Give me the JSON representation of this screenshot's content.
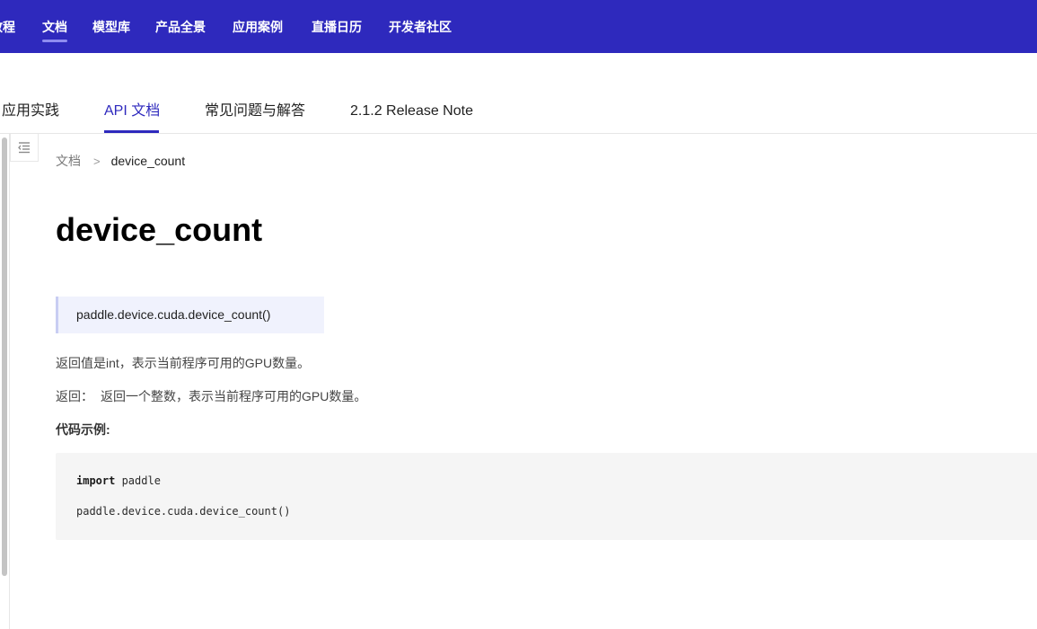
{
  "topnav": {
    "items": [
      {
        "label": "教程"
      },
      {
        "label": "文档"
      },
      {
        "label": "模型库"
      },
      {
        "label": "产品全景"
      },
      {
        "label": "应用案例"
      },
      {
        "label": "直播日历"
      },
      {
        "label": "开发者社区"
      }
    ],
    "active_index": 1
  },
  "tabs": {
    "items": [
      {
        "label": "应用实践"
      },
      {
        "label": "API 文档"
      },
      {
        "label": "常见问题与解答"
      },
      {
        "label": "2.1.2 Release Note"
      }
    ],
    "active_index": 1
  },
  "sidebar_toggle": {
    "icon": "list-collapse-icon"
  },
  "breadcrumb": {
    "root": "文档",
    "separator": ">",
    "current": "device_count"
  },
  "doc": {
    "title": "device_count",
    "signature": "paddle.device.cuda.device_count()",
    "description": "返回值是int，表示当前程序可用的GPU数量。",
    "returns_label": "返回：",
    "returns_text": "返回一个整数，表示当前程序可用的GPU数量。",
    "example_label": "代码示例:",
    "code": {
      "line1_keyword": "import",
      "line1_rest": " paddle",
      "line2": "paddle.device.cuda.device_count()"
    }
  },
  "colors": {
    "brand": "#2e29bd",
    "signature_bg": "#f0f2fd",
    "code_bg": "#f5f5f5"
  }
}
